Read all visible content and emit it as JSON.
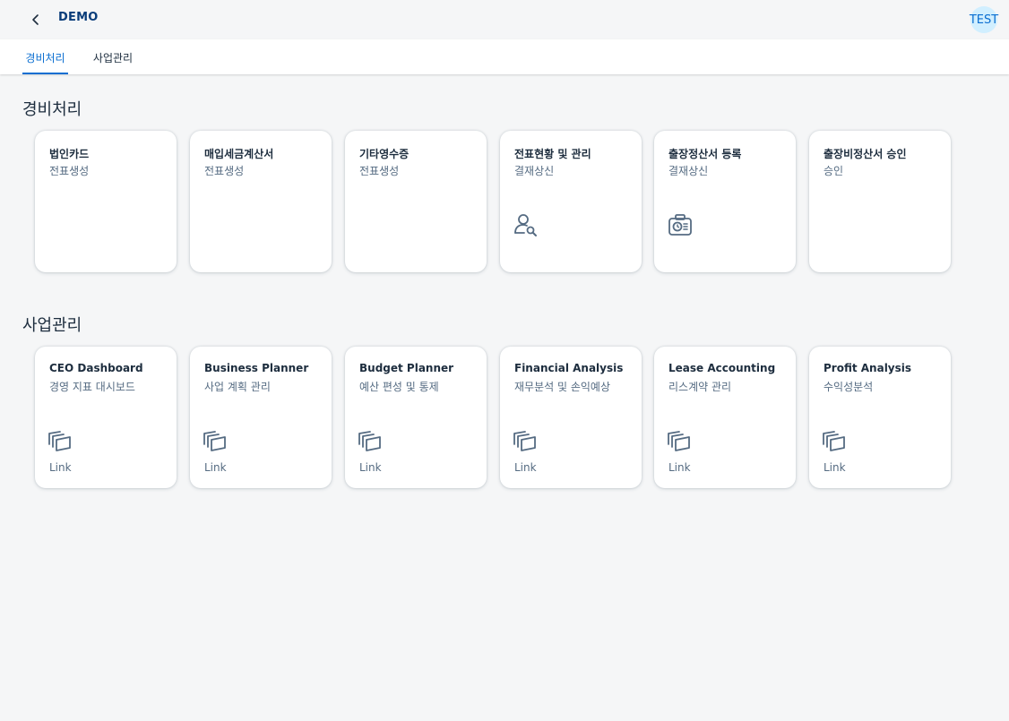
{
  "header": {
    "back_icon": "chevron-left-icon",
    "title": "DEMO",
    "avatar_initials": "TEST"
  },
  "tabs": [
    {
      "label": "경비처리",
      "active": true
    },
    {
      "label": "사업관리",
      "active": false
    }
  ],
  "sections": [
    {
      "title": "경비처리",
      "tiles": [
        {
          "title": "법인카드",
          "subtitle": "전표생성",
          "icon": "",
          "footer": ""
        },
        {
          "title": "매입세금계산서",
          "subtitle": "전표생성",
          "icon": "",
          "footer": ""
        },
        {
          "title": "기타영수증",
          "subtitle": "전표생성",
          "icon": "",
          "footer": ""
        },
        {
          "title": "전표현황 및 관리",
          "subtitle": "결재상신",
          "icon": "person-search-icon",
          "footer": ""
        },
        {
          "title": "출장정산서 등록",
          "subtitle": "결재상신",
          "icon": "expense-report-icon",
          "footer": ""
        },
        {
          "title": "출장비정산서 승인",
          "subtitle": "승인",
          "icon": "",
          "footer": ""
        }
      ]
    },
    {
      "title": "사업관리",
      "tiles": [
        {
          "title": "CEO Dashboard",
          "subtitle": "경영 지표 대시보드",
          "icon": "multiple-windows-icon",
          "footer": "Link"
        },
        {
          "title": "Business Planner",
          "subtitle": "사업 계획 관리",
          "icon": "multiple-windows-icon",
          "footer": "Link"
        },
        {
          "title": "Budget Planner",
          "subtitle": "예산 편성 및 통제",
          "icon": "multiple-windows-icon",
          "footer": "Link"
        },
        {
          "title": "Financial Analysis",
          "subtitle": "재무분석 및 손익예상",
          "icon": "multiple-windows-icon",
          "footer": "Link"
        },
        {
          "title": "Lease Accounting",
          "subtitle": "리스계약 관리",
          "icon": "multiple-windows-icon",
          "footer": "Link"
        },
        {
          "title": "Profit Analysis",
          "subtitle": "수익성분석",
          "icon": "multiple-windows-icon",
          "footer": "Link"
        }
      ]
    }
  ],
  "colors": {
    "accent": "#0a6ed1",
    "title_color": "#0a3d7a",
    "background": "#f5f6f7",
    "avatar_bg": "#d1efff"
  }
}
